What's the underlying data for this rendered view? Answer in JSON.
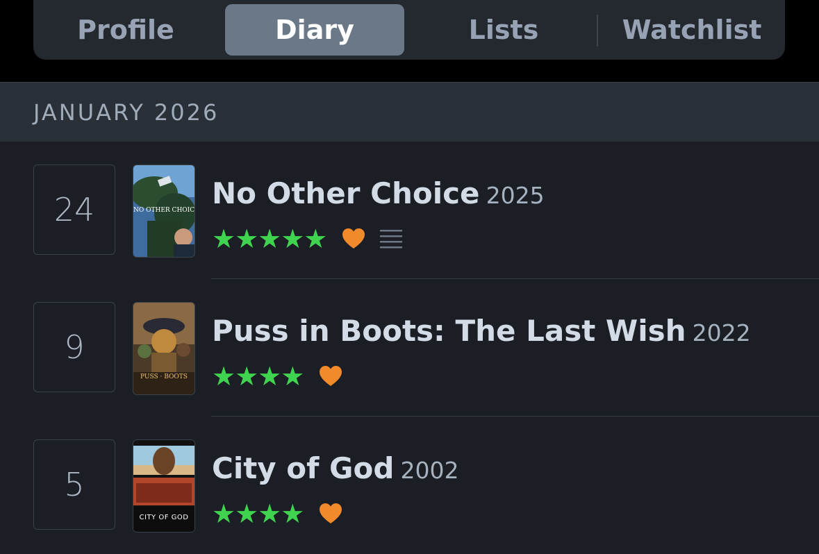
{
  "tabs": [
    {
      "label": "Profile",
      "active": false
    },
    {
      "label": "Diary",
      "active": true
    },
    {
      "label": "Lists",
      "active": false
    },
    {
      "label": "Watchlist",
      "active": false
    }
  ],
  "month": "JANUARY 2026",
  "entries": [
    {
      "day": "24",
      "title": "No Other Choice",
      "year": "2025",
      "stars": "★★★★★",
      "rating": 5,
      "liked": true,
      "has_review": true,
      "poster_text": "NO OTHER CHOICE",
      "poster_icon": "poster-no-other-choice"
    },
    {
      "day": "9",
      "title": "Puss in Boots: The Last Wish",
      "year": "2022",
      "stars": "★★★★",
      "rating": 4,
      "liked": true,
      "has_review": false,
      "poster_text": "PUSS · BOOTS",
      "poster_icon": "poster-puss-in-boots"
    },
    {
      "day": "5",
      "title": "City of God",
      "year": "2002",
      "stars": "★★★★",
      "rating": 4,
      "liked": true,
      "has_review": false,
      "poster_text": "CITY OF GOD",
      "poster_icon": "poster-city-of-god"
    }
  ],
  "colors": {
    "star": "#40d34f",
    "heart": "#f08a2a",
    "active_tab": "#6b7888",
    "background": "#1b1e24"
  }
}
